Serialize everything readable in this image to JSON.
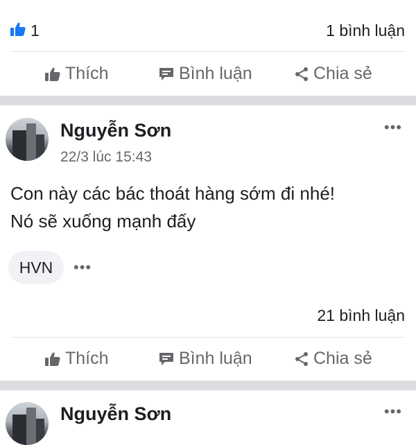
{
  "post_top": {
    "like_count": "1",
    "comment_count": "1 bình luận"
  },
  "actions": {
    "like": "Thích",
    "comment": "Bình luận",
    "share": "Chia sẻ"
  },
  "post_main": {
    "author": "Nguyễn Sơn",
    "timestamp": "22/3 lúc 15:43",
    "text_line1": "Con này các bác thoát hàng sớm đi nhé!",
    "text_line2": "Nó sẽ xuống mạnh đấy",
    "tag": "HVN",
    "more_symbol": "•••",
    "tag_more_symbol": "•••",
    "comment_count": "21 bình luận"
  },
  "post_next": {
    "author": "Nguyễn Sơn",
    "more_symbol": "•••"
  },
  "colors": {
    "like_blue": "#1877f2",
    "muted_text": "#65676b",
    "separator": "#dcdde0"
  }
}
